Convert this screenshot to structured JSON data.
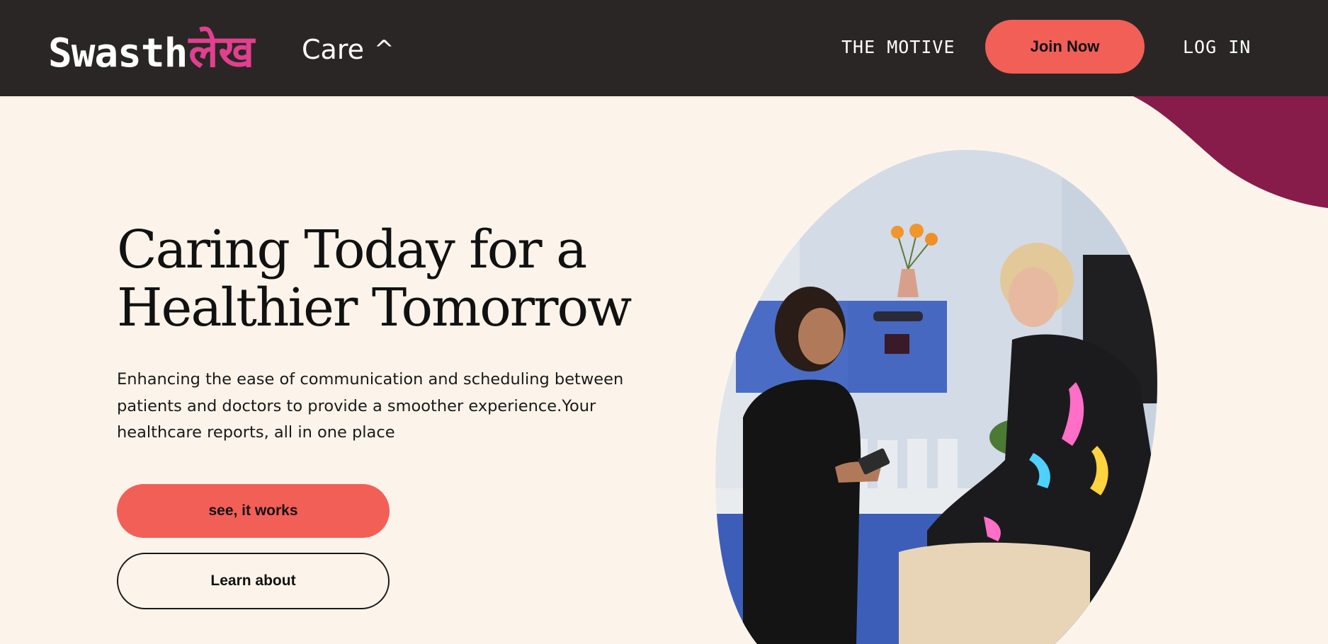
{
  "nav": {
    "logo_en": "Swasth",
    "logo_hi": "लेख",
    "care_label": "Care",
    "care_caret": "^",
    "motive_link": "THE MOTIVE",
    "join_button": "Join Now",
    "login_link": "LOG IN"
  },
  "hero": {
    "title_line1": "Caring Today for a",
    "title_line2": "Healthier Tomorrow",
    "description": "Enhancing the ease of communication and scheduling between patients and doctors to provide a smoother experience.Your healthcare reports, all in one place",
    "primary_button": "see, it works",
    "secondary_button": "Learn about"
  },
  "colors": {
    "navbar": "#2a2626",
    "background": "#fcf4ea",
    "accent": "#f25f57",
    "logo_pink": "#e23f8f",
    "blob": "#871b4a"
  },
  "icons": {
    "care_caret": "caret-up-icon"
  }
}
